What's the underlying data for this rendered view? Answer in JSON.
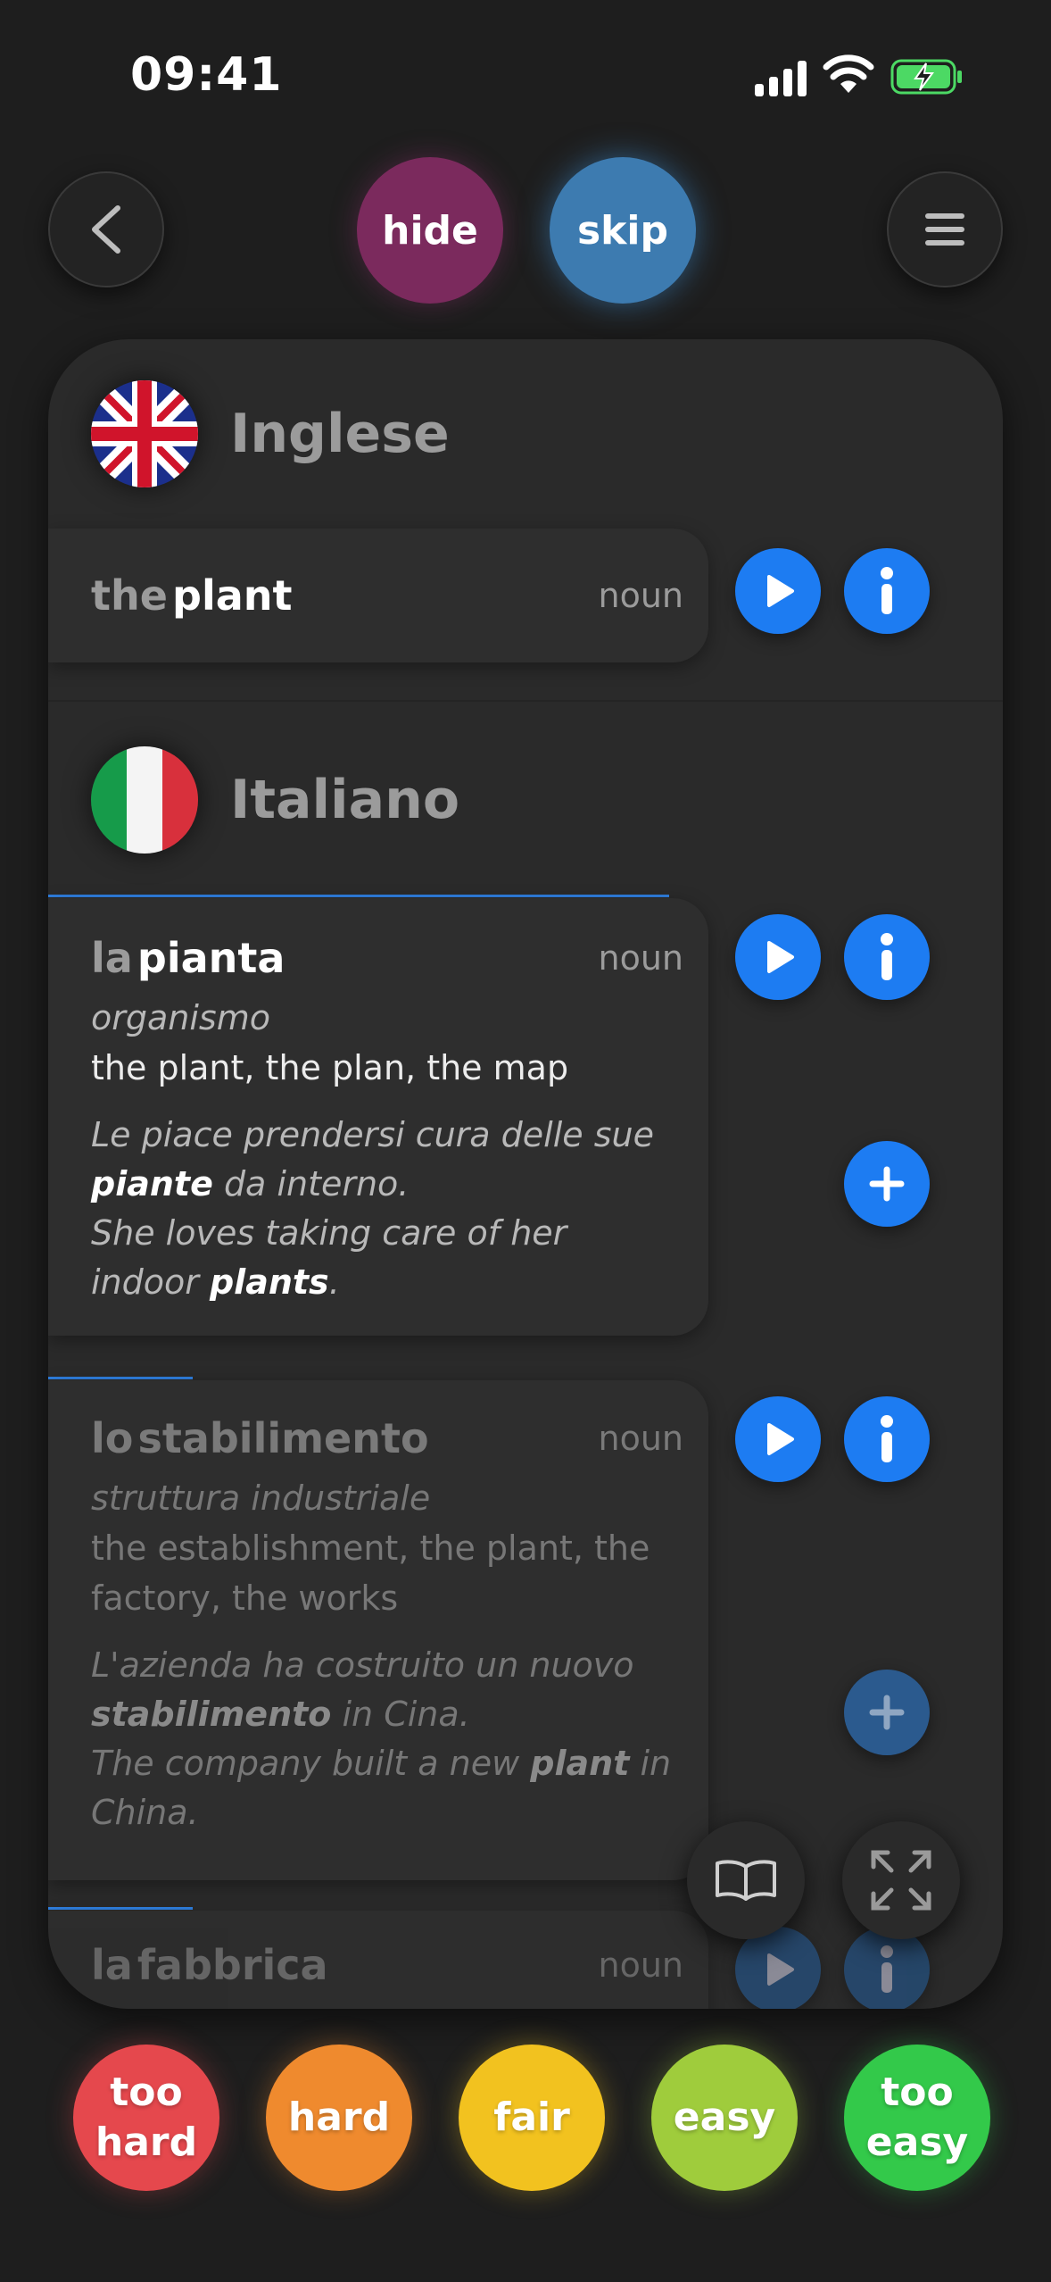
{
  "status": {
    "time": "09:41"
  },
  "top": {
    "hide_label": "hide",
    "skip_label": "skip"
  },
  "source": {
    "language": "Inglese",
    "entry": {
      "article": "the",
      "word": "plant",
      "pos": "noun"
    }
  },
  "target": {
    "language": "Italiano",
    "entries": [
      {
        "article": "la",
        "word": "pianta",
        "pos": "noun",
        "sense": "organismo",
        "translations": "the plant, the plan, the map",
        "example_it_pre": "Le piace prendersi cura delle sue ",
        "example_it_bold": "piante",
        "example_it_post": " da interno.",
        "example_en_pre": "She loves taking care of her indoor ",
        "example_en_bold": "plants",
        "example_en_post": "."
      },
      {
        "article": "lo",
        "word": "stabilimento",
        "pos": "noun",
        "sense": "struttura industriale",
        "translations": "the establishment, the plant, the factory, the works",
        "example_it_pre": "L'azienda ha costruito un nuovo ",
        "example_it_bold": "stabilimento",
        "example_it_post": " in Cina.",
        "example_en_pre": "The company built a new ",
        "example_en_bold": "plant",
        "example_en_post": " in China."
      },
      {
        "article": "la",
        "word": "fabbrica",
        "pos": "noun"
      }
    ]
  },
  "ratings": [
    {
      "label": "too\nhard",
      "color": "#e5484d"
    },
    {
      "label": "hard",
      "color": "#ef8a2e"
    },
    {
      "label": "fair",
      "color": "#f2c21f"
    },
    {
      "label": "easy",
      "color": "#9fcc3c"
    },
    {
      "label": "too\neasy",
      "color": "#33c94a"
    }
  ],
  "icons": [
    "back-chevron-icon",
    "menu-icon",
    "play-icon",
    "info-icon",
    "plus-icon",
    "book-icon",
    "expand-icon",
    "uk-flag-icon",
    "italy-flag-icon",
    "signal-icon",
    "wifi-icon",
    "battery-charging-icon"
  ]
}
